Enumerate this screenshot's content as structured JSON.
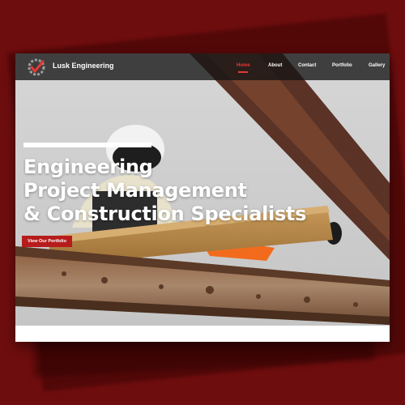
{
  "brand": {
    "name": "Lusk Engineering",
    "logo_icon": "gear-check-logo-icon"
  },
  "nav": {
    "items": [
      {
        "label": "Home",
        "active": true
      },
      {
        "label": "About",
        "active": false
      },
      {
        "label": "Contact",
        "active": false
      },
      {
        "label": "Portfolio",
        "active": false
      },
      {
        "label": "Gallery",
        "active": false
      }
    ]
  },
  "hero": {
    "headline_lines": [
      "Engineering",
      "Project Management",
      "& Construction Specialists"
    ],
    "cta_label": "View Our Portfolio"
  },
  "colors": {
    "background": "#6e0d0e",
    "accent": "#e53935",
    "cta": "#b71c1c",
    "navbar": "#141414"
  }
}
